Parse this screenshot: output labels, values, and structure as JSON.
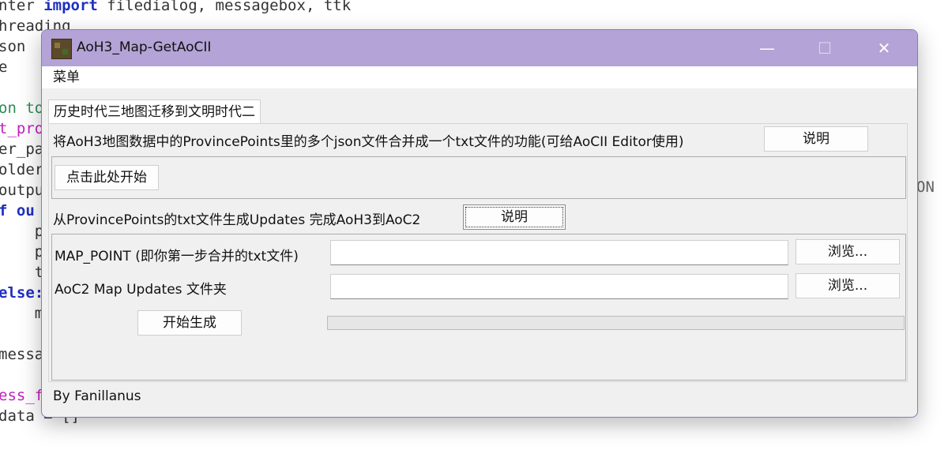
{
  "background_code": {
    "lines": [
      {
        "pre": "nter ",
        "kw": "import",
        "post": " filedialog, messagebox, ttk"
      },
      {
        "pre": "hreading"
      },
      {
        "pre": "son"
      },
      {
        "pre": "e"
      },
      {
        "pre": ""
      },
      {
        "pre": "on to"
      },
      {
        "pre": "t_pro"
      },
      {
        "pre": "er_pa"
      },
      {
        "pre": "older"
      },
      {
        "pre": "outpu"
      },
      {
        "pre": "f ou"
      },
      {
        "pre": "    p"
      },
      {
        "pre": "    p"
      },
      {
        "pre": "    t"
      },
      {
        "pre": "else:"
      },
      {
        "pre": "    m"
      },
      {
        "pre": ""
      },
      {
        "pre": "messa"
      },
      {
        "pre": ""
      },
      {
        "pre": "ess_f"
      },
      {
        "pre": "data = []"
      }
    ],
    "right_fragment": "ON"
  },
  "window": {
    "title": "AoH3_Map-GetAoCII",
    "minimize": "—",
    "maximize": "☐",
    "close": "✕"
  },
  "menu": {
    "label": "菜单"
  },
  "tab": {
    "label": "历史时代三地图迁移到文明时代二"
  },
  "section1": {
    "description": "将AoH3地图数据中的ProvincePoints里的多个json文件合并成一个txt文件的功能(可给AoCII Editor使用)",
    "help_button": "说明",
    "start_button": "点击此处开始"
  },
  "section2": {
    "description": "从ProvincePoints的txt文件生成Updates 完成AoH3到AoC2",
    "help_button": "说明",
    "map_point_label": "MAP_POINT (即你第一步合并的txt文件)",
    "map_point_value": "",
    "browse1": "浏览...",
    "updates_label": "AoC2 Map Updates 文件夹",
    "updates_value": "",
    "browse2": "浏览...",
    "generate_button": "开始生成",
    "progress": 0
  },
  "footer": {
    "author": "By Fanillanus"
  }
}
